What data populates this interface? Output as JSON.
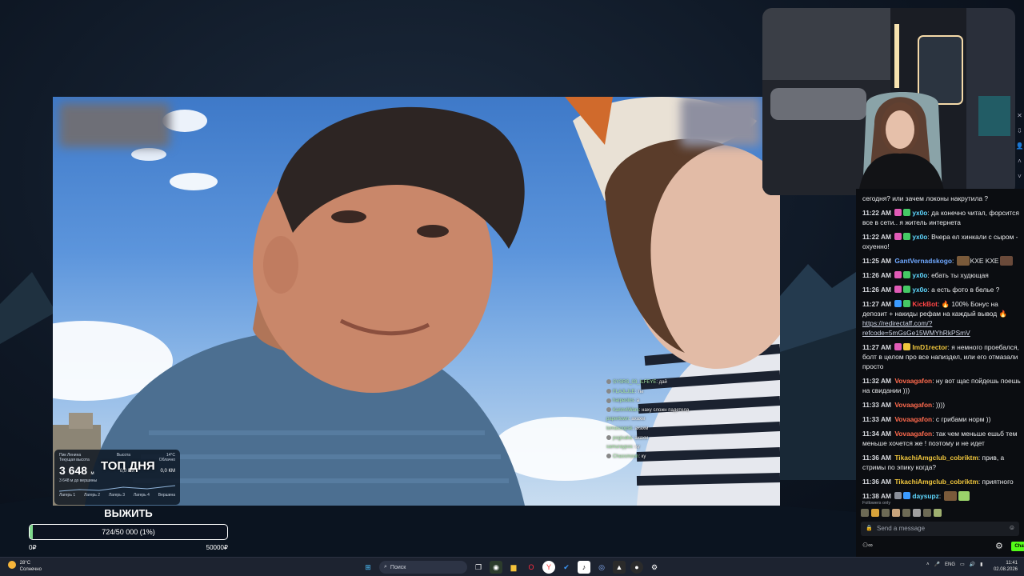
{
  "stats_widget": {
    "location": "Пик Ленина",
    "altitude_label": "Высота",
    "temperature": "14°C",
    "weather": "Облачно",
    "current_label": "Текущая высота",
    "altitude_value": "3 648",
    "altitude_unit": "м",
    "sub_value": "3 648 м до вершины",
    "dist1": "0,0 КМ",
    "dist2": "0,0 КМ",
    "top_day": "ТОП ДНЯ",
    "bottom_labels": [
      "Лагерь 1",
      "Лагерь 2",
      "Лагерь 3",
      "Лагерь 4",
      "Вершина"
    ]
  },
  "goal": {
    "title": "ВЫЖИТЬ",
    "progress_text": "724/50 000 (1%)",
    "progress_fraction": 0.0145,
    "min_label": "0₽",
    "max_label": "50000₽"
  },
  "video_chat": [
    {
      "user": "SYSRS_03_ILFEYE",
      "text": "дай"
    },
    {
      "user": "FLAJLJLE",
      "text": "ты"
    },
    {
      "user": "harpeolos",
      "text": "а"
    },
    {
      "user": "Karim4Wars",
      "text": "наху сложн падетела"
    },
    {
      "user": "papertown",
      "text": "ахахм"
    },
    {
      "user": "tomasoopsk",
      "text": "ахахм"
    },
    {
      "user": "pogisaka",
      "text": "ахахм"
    },
    {
      "user": "samuraypos",
      "text": "ку"
    },
    {
      "user": "Chaosmoon",
      "text": "ку"
    }
  ],
  "chat": {
    "messages": [
      {
        "time": "",
        "user": "",
        "user_color": "#ffffff",
        "badges": [],
        "text": "сегодня? или зачем локоны накрутила ?"
      },
      {
        "time": "11:22 AM",
        "user": "yx0o",
        "user_color": "#5fd8ff",
        "badges": [
          "#e05bb6",
          "#45c965"
        ],
        "text": "да конечно читал, форсится все в сети.. я житель интернета"
      },
      {
        "time": "11:22 AM",
        "user": "yx0o",
        "user_color": "#5fd8ff",
        "badges": [
          "#e05bb6",
          "#45c965"
        ],
        "text": "Вчера ел хинкали с сыром - охуенно!"
      },
      {
        "time": "11:25 AM",
        "user": "GantVernadskogo",
        "user_color": "#6fa8ff",
        "badges": [],
        "text": "KXE KXE",
        "emote_after": true
      },
      {
        "time": "11:26 AM",
        "user": "yx0o",
        "user_color": "#5fd8ff",
        "badges": [
          "#e05bb6",
          "#45c965"
        ],
        "text": "ебать ты худющая"
      },
      {
        "time": "11:26 AM",
        "user": "yx0o",
        "user_color": "#5fd8ff",
        "badges": [
          "#e05bb6",
          "#45c965"
        ],
        "text": "а есть фото в белье ?"
      },
      {
        "time": "11:27 AM",
        "user": "KickBot",
        "user_color": "#ff4545",
        "badges": [
          "#3b9bff",
          "#45c965"
        ],
        "text": "🔥 100% Бонус на депозит + накиды рефам на каждый вывод 🔥",
        "link": "https://redirectaff.com/?refcode=5mGsGe15WMYhRkPSmV"
      },
      {
        "time": "11:27 AM",
        "user": "ImD1rector",
        "user_color": "#f0c63d",
        "badges": [
          "#e05bb6",
          "#f0c63d"
        ],
        "text": "я немного проебался, болт в целом про все напиздел, или его отмазали просто"
      },
      {
        "time": "11:32 AM",
        "user": "Vovaagafon",
        "user_color": "#ff6a4d",
        "badges": [],
        "text": "ну вот щас пойдешь поешь на свидании )))"
      },
      {
        "time": "11:33 AM",
        "user": "Vovaagafon",
        "user_color": "#ff6a4d",
        "badges": [],
        "text": "))))"
      },
      {
        "time": "11:33 AM",
        "user": "Vovaagafon",
        "user_color": "#ff6a4d",
        "badges": [],
        "text": "с грибами норм ))"
      },
      {
        "time": "11:34 AM",
        "user": "Vovaagafon",
        "user_color": "#ff6a4d",
        "badges": [],
        "text": "так чем меньше ешьб тем меньше хочется же ! поэтому и не идет"
      },
      {
        "time": "11:36 AM",
        "user": "TikachiAmgclub_cobriktm",
        "user_color": "#f0c63d",
        "badges": [],
        "text": "прив, а стримы по эпику когда?"
      },
      {
        "time": "11:36 AM",
        "user": "TikachiAmgclub_cobriktm",
        "user_color": "#f0c63d",
        "badges": [],
        "text": "приятного"
      },
      {
        "time": "11:38 AM",
        "user": "daysupz",
        "user_color": "#5fd8ff",
        "badges": [
          "#8a8f99",
          "#3b9bff"
        ],
        "text": "",
        "emote_after": true
      }
    ],
    "followers_only": "Followers only",
    "input_placeholder": "Send a message",
    "send_label": "Chat",
    "users_icon": "users-icon"
  },
  "taskbar": {
    "temperature": "28°C",
    "weather": "Солнечно",
    "search_placeholder": "Поиск",
    "language": "ENG",
    "time": "11:41",
    "date": "02.08.2026"
  },
  "colors": {
    "kick_green": "#53fc18",
    "goal_fill": "#7fd98c",
    "chat_bg": "#0b0d11",
    "taskbar_bg": "#1d2330"
  }
}
